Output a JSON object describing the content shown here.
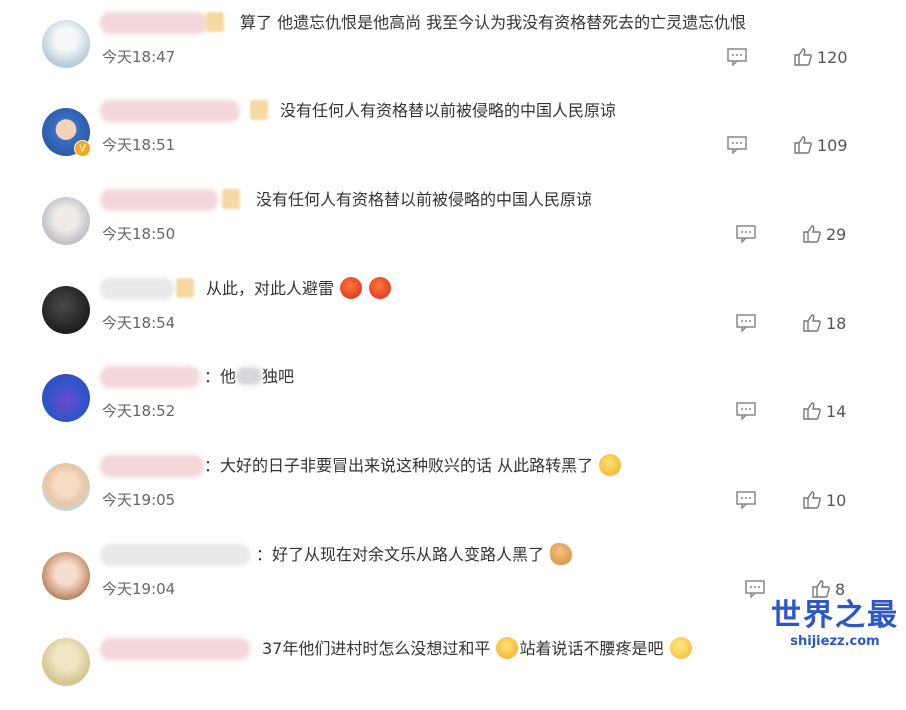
{
  "comments": [
    {
      "text": "算了 他遗忘仇恨是他高尚 我至今认为我没有资格替死去的亡灵遗忘仇恨",
      "time": "今天18:47",
      "likes": "120",
      "avatar_color": "#d9e6ee",
      "avatar_icon": "avatar-girl-light"
    },
    {
      "text": "没有任何人有资格替以前被侵略的中国人民原谅",
      "time": "今天18:51",
      "likes": "109",
      "avatar_color": "#3a6fc2",
      "avatar_icon": "avatar-child"
    },
    {
      "text": "没有任何人有资格替以前被侵略的中国人民原谅",
      "time": "今天18:50",
      "likes": "29",
      "avatar_color": "#c9cbd0",
      "avatar_icon": "avatar-silver-hair"
    },
    {
      "text": "从此，对此人避雷",
      "time": "今天18:54",
      "likes": "18",
      "avatar_color": "#2a2a2c",
      "avatar_icon": "avatar-dark-circle"
    },
    {
      "text_a": "：他",
      "text_b": "独吧",
      "time": "今天18:52",
      "likes": "14",
      "avatar_color": "#5a3fb8",
      "avatar_icon": "avatar-purple"
    },
    {
      "text": "：大好的日子非要冒出来说这种败兴的话 从此路转黑了",
      "time": "今天19:05",
      "likes": "10",
      "avatar_color": "#f0e2d0",
      "avatar_icon": "avatar-cartoon"
    },
    {
      "text": "：好了从现在对余文乐从路人变路人黑了",
      "time": "今天19:04",
      "likes": "8",
      "avatar_color": "#d8a98a",
      "avatar_icon": "avatar-woman"
    },
    {
      "text_a": "37年他们进村时怎么没想过和平",
      "text_b": "站着说话不腰疼是吧",
      "avatar_color": "#d4c48f",
      "avatar_icon": "avatar-partial"
    }
  ],
  "watermark": {
    "title": "世界之最",
    "url": "shijiezz.com"
  }
}
